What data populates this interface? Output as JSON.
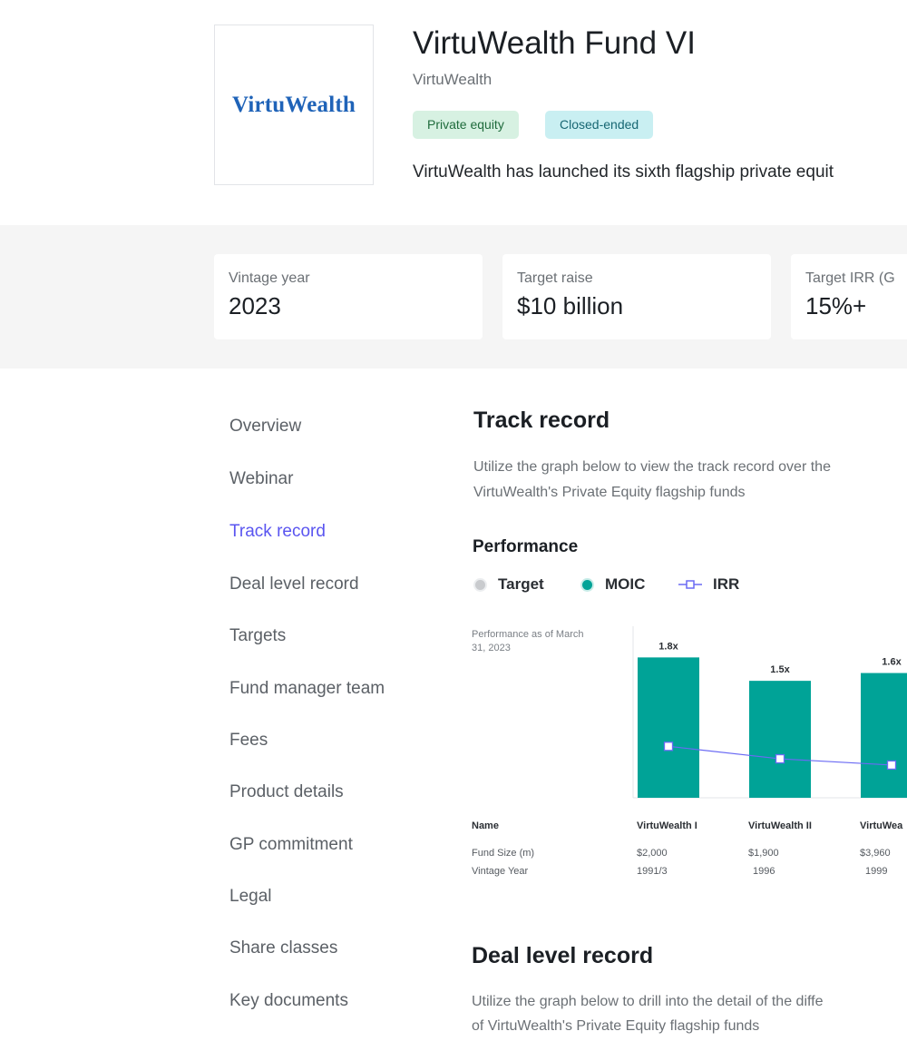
{
  "header": {
    "logo_text": "VirtuWealth",
    "title": "VirtuWealth Fund VI",
    "manager": "VirtuWealth",
    "tags": [
      {
        "label": "Private equity"
      },
      {
        "label": "Closed-ended"
      }
    ],
    "description": "VirtuWealth has launched its sixth flagship private equit"
  },
  "stats": [
    {
      "label": "Vintage year",
      "value": "2023"
    },
    {
      "label": "Target raise",
      "value": "$10 billion"
    },
    {
      "label": "Target IRR (G",
      "value": "15%+"
    }
  ],
  "nav": {
    "items": [
      {
        "label": "Overview"
      },
      {
        "label": "Webinar"
      },
      {
        "label": "Track record",
        "active": true
      },
      {
        "label": "Deal level record"
      },
      {
        "label": "Targets"
      },
      {
        "label": "Fund manager team"
      },
      {
        "label": "Fees"
      },
      {
        "label": "Product details"
      },
      {
        "label": "GP commitment"
      },
      {
        "label": "Legal"
      },
      {
        "label": "Share classes"
      },
      {
        "label": "Key documents"
      }
    ]
  },
  "track_record": {
    "title": "Track record",
    "description_lines": [
      "Utilize the graph below to view the track record over the",
      "VirtuWealth's Private Equity flagship funds"
    ],
    "performance_title": "Performance",
    "legend": [
      {
        "label": "Target",
        "color": "#c9cbce"
      },
      {
        "label": "MOIC",
        "color": "#00a397"
      },
      {
        "label": "IRR",
        "color": "#6a6af4"
      }
    ],
    "as_of": "Performance as of March 31, 2023",
    "table": {
      "row_labels": [
        "Name",
        "Fund Size (m)",
        "Vintage Year"
      ],
      "funds": [
        {
          "name": "VirtuWealth I",
          "size": "$2,000",
          "vintage": "1991/3"
        },
        {
          "name": "VirtuWealth II",
          "size": "$1,900",
          "vintage": "1996"
        },
        {
          "name": "VirtuWea",
          "size": "$3,960",
          "vintage": "1999"
        }
      ]
    }
  },
  "chart_data": {
    "type": "bar",
    "categories": [
      "VirtuWealth I",
      "VirtuWealth II",
      "VirtuWea"
    ],
    "series": [
      {
        "name": "MOIC",
        "values": [
          1.8,
          1.5,
          1.6
        ],
        "labels": [
          "1.8x",
          "1.5x",
          "1.6x"
        ],
        "color": "#00a397"
      },
      {
        "name": "IRR",
        "values": [
          0.66,
          0.5,
          0.42
        ],
        "color": "#6a6af4"
      }
    ],
    "ylim": [
      0,
      2.2
    ],
    "grid": false,
    "legend_position": "top-left"
  },
  "deal_level": {
    "title": "Deal level record",
    "description_lines": [
      "Utilize the graph below to drill into the detail of the diffe",
      "of VirtuWealth's Private Equity flagship funds"
    ]
  }
}
